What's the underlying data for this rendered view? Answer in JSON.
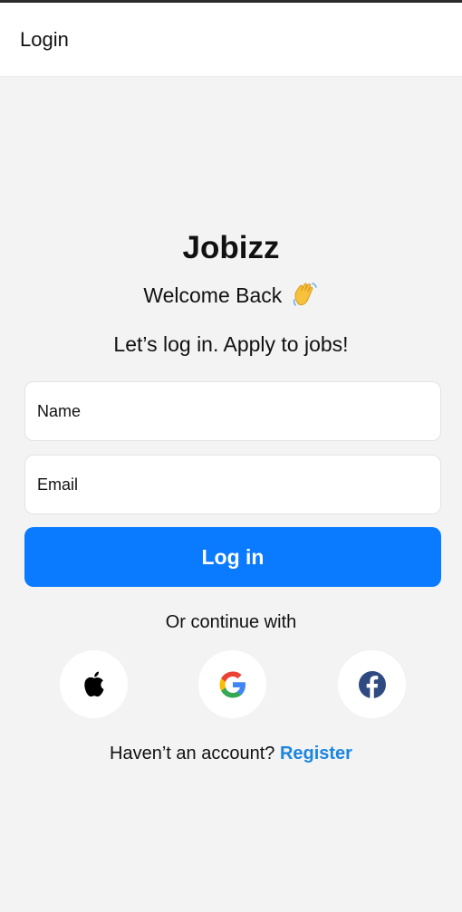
{
  "appbar": {
    "title": "Login"
  },
  "brand": {
    "name": "Jobizz"
  },
  "welcome": {
    "text": "Welcome Back",
    "emoji_icon": "waving-hand-icon"
  },
  "tagline": "Let’s log in. Apply to jobs!",
  "form": {
    "name_placeholder": "Name",
    "email_placeholder": "Email",
    "login_label": "Log in"
  },
  "social": {
    "heading": "Or continue with",
    "providers": [
      {
        "name": "Apple",
        "icon": "apple-icon"
      },
      {
        "name": "Google",
        "icon": "google-icon"
      },
      {
        "name": "Facebook",
        "icon": "facebook-icon"
      }
    ]
  },
  "register": {
    "prompt": "Haven’t an account?",
    "link_label": "Register"
  },
  "colors": {
    "primary": "#0a7bff",
    "link": "#1a86e0",
    "background": "#f3f3f3",
    "facebook": "#2f4a80"
  }
}
